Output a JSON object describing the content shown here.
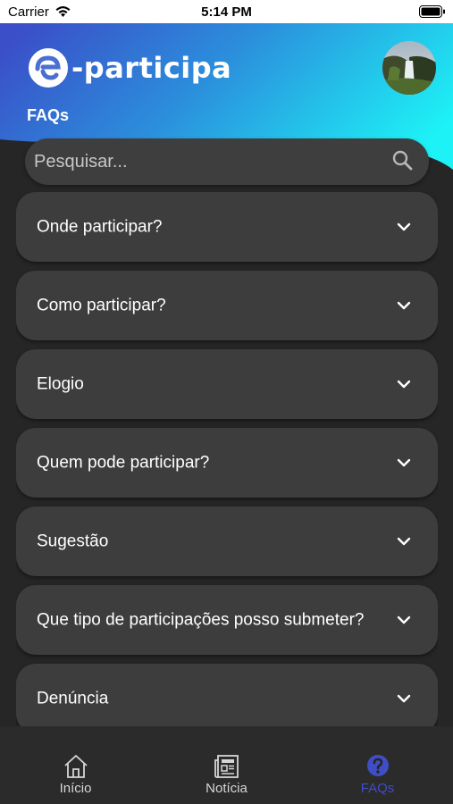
{
  "status_bar": {
    "carrier": "Carrier",
    "time": "5:14 PM"
  },
  "header": {
    "logo_text": "-participa",
    "page_title": "FAQs"
  },
  "search": {
    "placeholder": "Pesquisar...",
    "value": ""
  },
  "faqs": [
    {
      "question": "Onde participar?"
    },
    {
      "question": "Como participar?"
    },
    {
      "question": "Elogio"
    },
    {
      "question": "Quem pode participar?"
    },
    {
      "question": "Sugestão"
    },
    {
      "question": "Que tipo de participações posso submeter?"
    },
    {
      "question": "Denúncia"
    }
  ],
  "bottom_nav": [
    {
      "label": "Início",
      "icon": "home-icon",
      "active": false
    },
    {
      "label": "Notícia",
      "icon": "newspaper-icon",
      "active": false
    },
    {
      "label": "FAQs",
      "icon": "question-circle-icon",
      "active": true
    }
  ],
  "colors": {
    "gradient_start": "#3a4fc8",
    "gradient_end": "#1df2f6",
    "background": "#262626",
    "card": "#3d3d3d",
    "active_nav": "#3f4ec4"
  }
}
